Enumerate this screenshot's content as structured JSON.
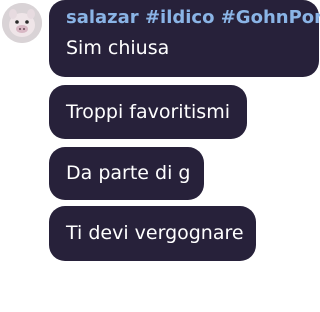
{
  "chat": {
    "sender": "salazar #ildico #GohnPork",
    "avatar_icon": "pig-face-avatar",
    "accent_color": "#8ab4e6",
    "bubble_color": "#27213a",
    "messages": [
      {
        "text": "Sim chiusa"
      },
      {
        "text": "Troppi favoritismi"
      },
      {
        "text": "Da parte di g"
      },
      {
        "text": "Ti devi vergognare"
      }
    ]
  }
}
